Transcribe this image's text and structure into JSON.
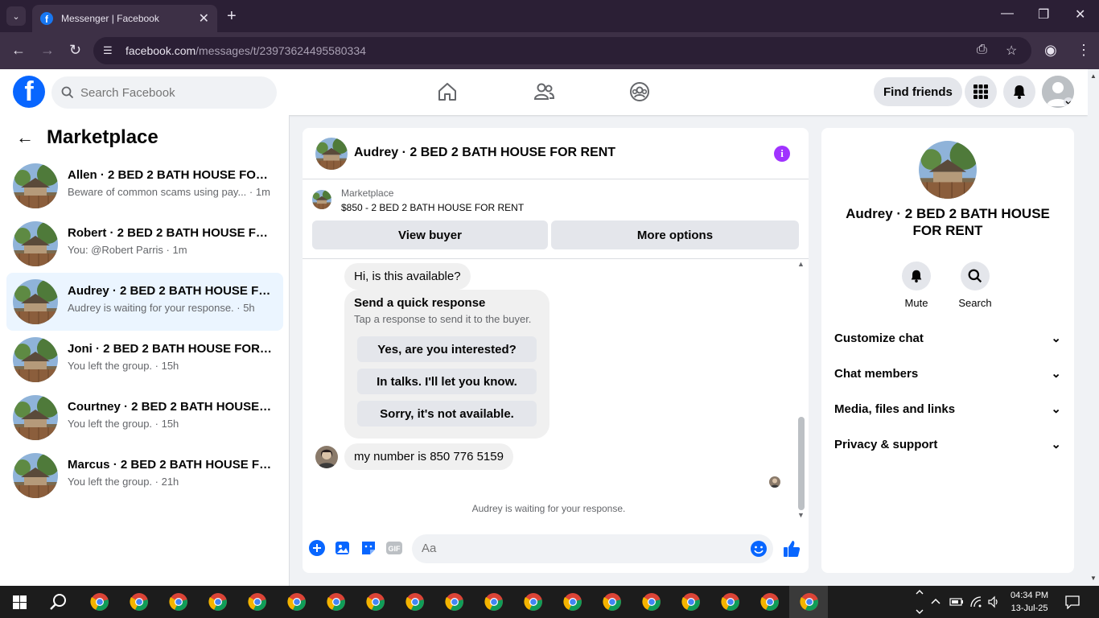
{
  "browser": {
    "tab_title": "Messenger | Facebook",
    "url_host": "facebook.com",
    "url_path": "/messages/t/23973624495580334"
  },
  "fb": {
    "search_placeholder": "Search Facebook",
    "find_friends": "Find friends"
  },
  "left": {
    "title": "Marketplace",
    "conversations": [
      {
        "name": "Allen · 2 BED 2 BATH HOUSE FOR RENT",
        "sub": "Beware of common scams using pay... · 1m",
        "active": false
      },
      {
        "name": "Robert · 2 BED 2 BATH HOUSE FOR RENT",
        "sub": "You: @Robert Parris · 1m",
        "active": false
      },
      {
        "name": "Audrey · 2 BED 2 BATH HOUSE FOR RENT",
        "sub": "Audrey is waiting for your response. · 5h",
        "active": true
      },
      {
        "name": "Joni · 2 BED 2 BATH HOUSE FOR RENT",
        "sub": "You left the group. · 15h",
        "active": false
      },
      {
        "name": "Courtney · 2 BED 2 BATH HOUSE FOR RENT",
        "sub": "You left the group. · 15h",
        "active": false
      },
      {
        "name": "Marcus · 2 BED 2 BATH HOUSE FOR RENT",
        "sub": "You left the group. · 21h",
        "active": false
      }
    ]
  },
  "chat": {
    "title": "Audrey · 2 BED 2 BATH HOUSE FOR RENT",
    "marketplace_label": "Marketplace",
    "listing": "$850 - 2 BED 2 BATH HOUSE FOR RENT",
    "view_buyer": "View buyer",
    "more_options": "More options",
    "msg1": "Hi, is this available?",
    "quick_title": "Send a quick response",
    "quick_sub": "Tap a response to send it to the buyer.",
    "quick_options": [
      "Yes, are you interested?",
      "In talks. I'll let you know.",
      "Sorry, it's not available."
    ],
    "msg2": "my number is 850 776 5159",
    "waiting": "Audrey is waiting for your response.",
    "composer_placeholder": "Aa"
  },
  "right": {
    "name": "Audrey · 2 BED 2 BATH HOUSE FOR RENT",
    "mute": "Mute",
    "search": "Search",
    "sections": [
      "Customize chat",
      "Chat members",
      "Media, files and links",
      "Privacy & support"
    ]
  },
  "taskbar": {
    "time": "04:34 PM",
    "date": "13-Jul-25"
  },
  "colors": {
    "fb_blue": "#0866ff",
    "active_row": "#ebf5ff",
    "info_purple": "#a033ff",
    "chrome_dark": "#2b1f35"
  }
}
